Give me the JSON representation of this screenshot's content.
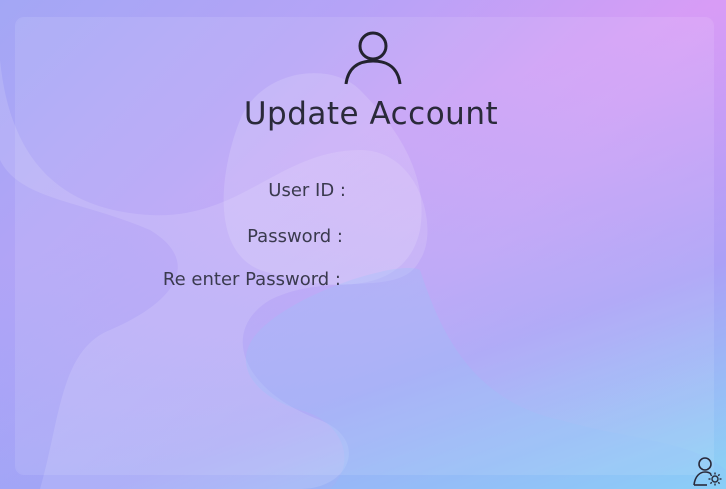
{
  "form": {
    "title": "Update Account",
    "user_id_label": "User ID :",
    "user_id_value": "",
    "password_label": "Password :",
    "password_value": "",
    "reenter_password_label": "Re enter Password :",
    "reenter_password_value": ""
  },
  "icons": {
    "header": "user-icon",
    "corner": "user-settings-icon"
  },
  "colors": {
    "text": "#2a2a3a",
    "label": "#3a3a4e",
    "gradient_top_right": "#e88ff6",
    "gradient_top_left": "#a3a7f5",
    "gradient_bottom_right": "#78e1f5"
  }
}
